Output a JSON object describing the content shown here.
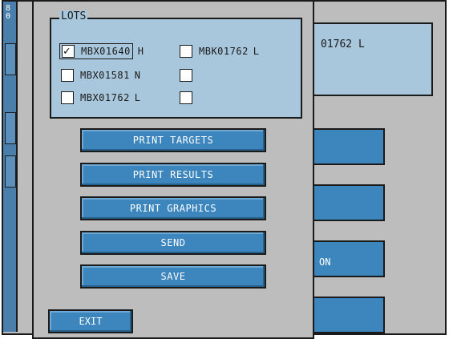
{
  "background": {
    "strip_text": "80",
    "panel_text": "01762  L",
    "button_fragment": "ON"
  },
  "dialog": {
    "lots_title": "LOTS",
    "lots": [
      {
        "name": "MBX01640",
        "level": "H",
        "checked": true
      },
      {
        "name": "MBX01581",
        "level": "N",
        "checked": false
      },
      {
        "name": "MBX01762",
        "level": "L",
        "checked": false
      },
      {
        "name": "MBK01762",
        "level": "L",
        "checked": false
      }
    ],
    "buttons": {
      "print_targets": "PRINT TARGETS",
      "print_results": "PRINT RESULTS",
      "print_graphics": "PRINT GRAPHICS",
      "send": "SEND",
      "save": "SAVE",
      "exit": "EXIT"
    }
  },
  "colors": {
    "button_blue": "#3c86bd",
    "panel_blue": "#a8c7dd",
    "window_gray": "#bdbdbd"
  }
}
